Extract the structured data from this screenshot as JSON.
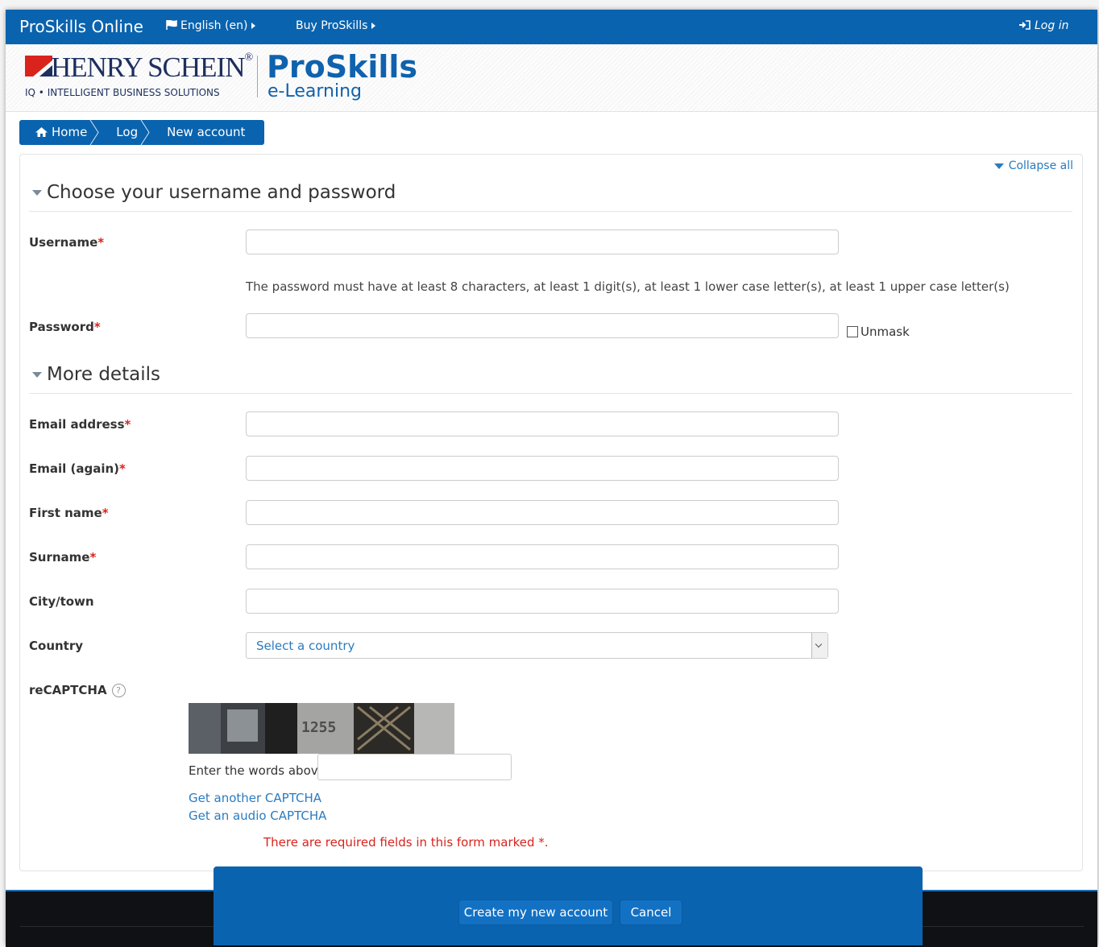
{
  "navbar": {
    "brand": "ProSkills Online",
    "language": "English (en)",
    "buy": "Buy ProSkills",
    "login": "Log in"
  },
  "header": {
    "logo_company": "HENRY SCHEIN",
    "logo_registered": "®",
    "logo_tagline": "IQ • INTELLIGENT BUSINESS SOLUTIONS",
    "logo_product": "ProSkills",
    "logo_subproduct": "e-Learning"
  },
  "breadcrumb": [
    "Home",
    "Log",
    "New account"
  ],
  "form": {
    "collapse_all": "Collapse all",
    "required_marker": "*",
    "section1_title": "Choose your username and password",
    "username_label": "Username",
    "password_hint": "The password must have at least 8 characters, at least 1 digit(s), at least 1 lower case letter(s), at least 1 upper case letter(s)",
    "password_label": "Password",
    "unmask_label": "Unmask",
    "section2_title": "More details",
    "email_label": "Email address",
    "email_again_label": "Email (again)",
    "firstname_label": "First name",
    "surname_label": "Surname",
    "city_label": "City/town",
    "country_label": "Country",
    "country_value": "Select a country",
    "recaptcha_label": "reCAPTCHA",
    "help_glyph": "?",
    "captcha_image_text": "1255",
    "captcha_prompt": "Enter the words above",
    "captcha_another": "Get another CAPTCHA",
    "captcha_audio": "Get an audio CAPTCHA",
    "required_note": "There are required fields in this form marked *."
  },
  "actions": {
    "create": "Create my new account",
    "cancel": "Cancel"
  },
  "colors": {
    "primary": "#0a63ae",
    "link": "#2a7bbf",
    "required": "#d9231c",
    "footer": "#0f1114"
  }
}
